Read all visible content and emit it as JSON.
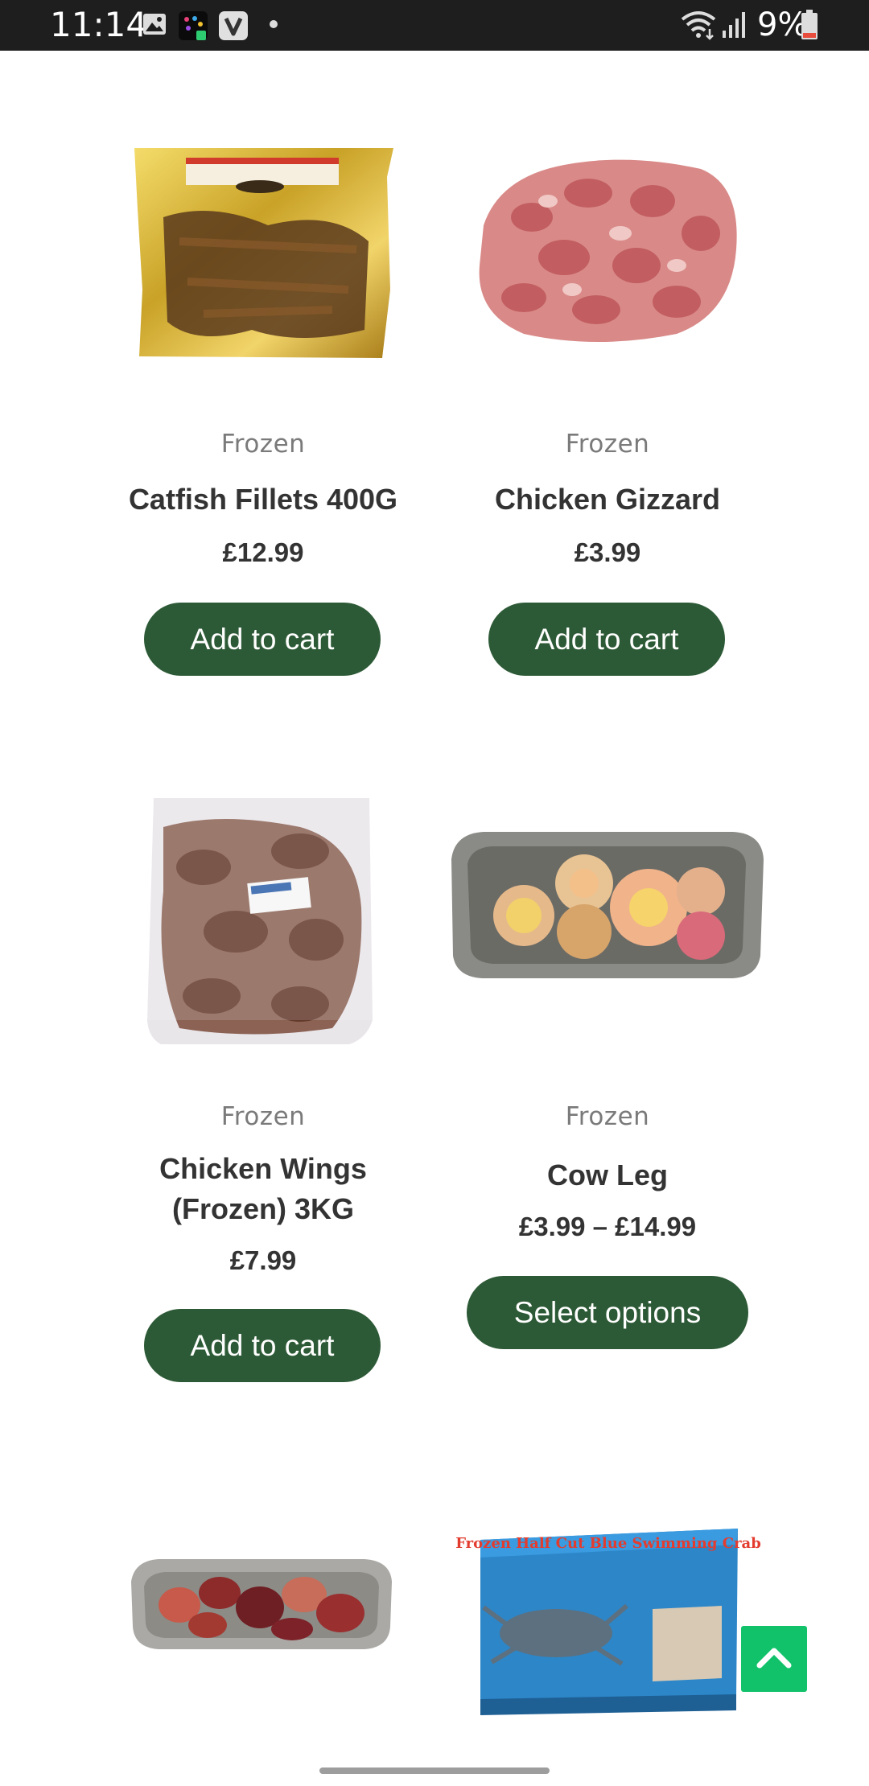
{
  "status_bar": {
    "time": "11:14",
    "battery": "9%",
    "icons": [
      "gallery-icon",
      "app-icon",
      "v-app-icon",
      "dot-icon",
      "wifi-icon",
      "signal-icon",
      "battery-icon"
    ]
  },
  "products": [
    {
      "category": "Frozen",
      "title": "Catfish Fillets 400G",
      "price": "£12.99",
      "button": "Add to cart",
      "image": "catfish-fillets-image"
    },
    {
      "category": "Frozen",
      "title": "Chicken Gizzard",
      "price": "£3.99",
      "button": "Add to cart",
      "image": "chicken-gizzard-image"
    },
    {
      "category": "Frozen",
      "title_line1": "Chicken Wings",
      "title_line2": "(Frozen) 3KG",
      "price": "£7.99",
      "button": "Add to cart",
      "image": "chicken-wings-image"
    },
    {
      "category": "Frozen",
      "title": "Cow Leg",
      "price": "£3.99 – £14.99",
      "button": "Select options",
      "image": "cow-leg-image"
    },
    {
      "image": "meat-tray-image"
    },
    {
      "image": "blue-swimming-crab-image",
      "package_text": "Frozen Half Cut Blue Swimming Crab"
    }
  ],
  "colors": {
    "button_bg": "#2d5a36",
    "scroll_top_bg": "#12c26b",
    "status_bar_bg": "#1e1e1e"
  }
}
